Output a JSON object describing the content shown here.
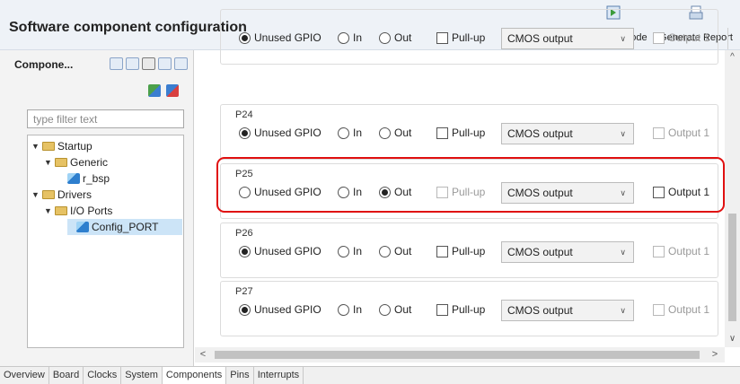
{
  "header": {
    "title": "Software component configuration",
    "generate_code_label": "Generate Code",
    "generate_report_label": "Generate Report"
  },
  "left_panel": {
    "title": "Compone...",
    "filter_placeholder": "type filter text",
    "tree": {
      "startup": "Startup",
      "generic": "Generic",
      "r_bsp": "r_bsp",
      "drivers": "Drivers",
      "io_ports": "I/O Ports",
      "config_port": "Config_PORT"
    }
  },
  "pins": [
    {
      "name": "",
      "mode": "Unused GPIO",
      "output_type": "CMOS output",
      "pullup_enabled": true,
      "output1_enabled": false
    },
    {
      "name": "P24",
      "mode": "Unused GPIO",
      "output_type": "CMOS output",
      "pullup_enabled": true,
      "output1_enabled": false
    },
    {
      "name": "P25",
      "mode": "Out",
      "output_type": "CMOS output",
      "pullup_enabled": false,
      "output1_enabled": true
    },
    {
      "name": "P26",
      "mode": "Unused GPIO",
      "output_type": "CMOS output",
      "pullup_enabled": true,
      "output1_enabled": false
    },
    {
      "name": "P27",
      "mode": "Unused GPIO",
      "output_type": "CMOS output",
      "pullup_enabled": true,
      "output1_enabled": false
    }
  ],
  "labels": {
    "unused_gpio": "Unused GPIO",
    "in": "In",
    "out": "Out",
    "pull_up": "Pull-up",
    "output1": "Output 1"
  },
  "highlight_color": "#e01010",
  "bottom_tabs": [
    "Overview",
    "Board",
    "Clocks",
    "System",
    "Components",
    "Pins",
    "Interrupts"
  ],
  "active_tab": "Components"
}
